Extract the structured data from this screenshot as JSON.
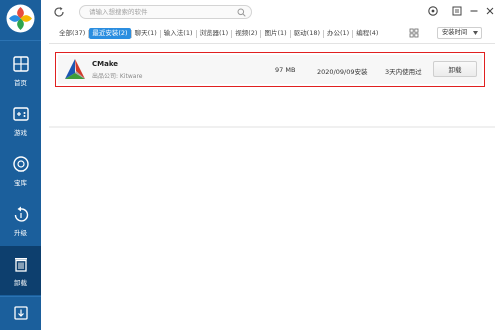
{
  "search": {
    "placeholder": "请输入想搜索的软件"
  },
  "sidebar": {
    "items": [
      {
        "label": "首页",
        "icon": "home-icon"
      },
      {
        "label": "游戏",
        "icon": "gamepad-icon"
      },
      {
        "label": "宝库",
        "icon": "treasure-icon"
      },
      {
        "label": "升级",
        "icon": "upgrade-icon"
      },
      {
        "label": "卸载",
        "icon": "trash-icon",
        "active": true
      },
      {
        "label": "",
        "icon": "download-icon"
      }
    ]
  },
  "tabs": [
    {
      "label": "全部(37)"
    },
    {
      "label": "最近安装(2)",
      "active": true
    },
    {
      "label": "聊天(1)"
    },
    {
      "label": "输入法(1)"
    },
    {
      "label": "浏览器(1)"
    },
    {
      "label": "视频(2)"
    },
    {
      "label": "图片(1)"
    },
    {
      "label": "驱动(18)"
    },
    {
      "label": "办公(1)"
    },
    {
      "label": "编程(4)"
    }
  ],
  "sort": {
    "selected": "安装时间"
  },
  "apps": [
    {
      "name": "CMake",
      "publisher": "出品公司: Kitware",
      "size": "97 MB",
      "installed": "2020/09/09安装",
      "usage": "3天内使用过",
      "action": "卸载"
    }
  ],
  "colors": {
    "sidebar": "#1b5f9c",
    "sidebar_active": "#0d3f6e",
    "tab_active": "#2b8ee0",
    "highlight": "#e02020"
  }
}
